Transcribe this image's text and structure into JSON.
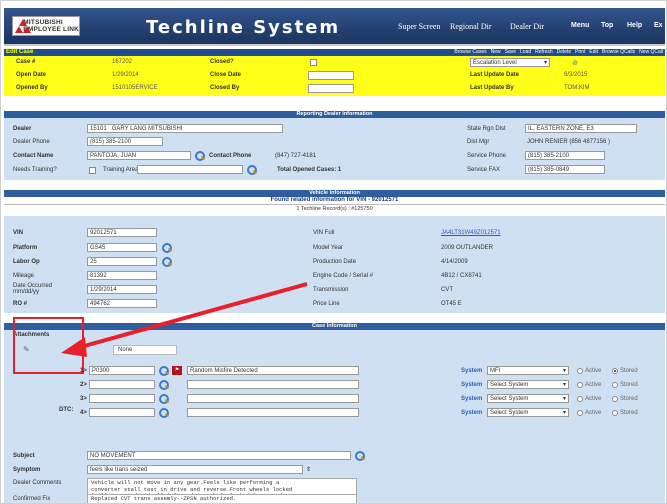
{
  "header": {
    "logo_text": "MITSUBISHI\nEMPLOYEE LINK",
    "title": "Techline System",
    "nav": [
      "Super Screen",
      "Regional Dir",
      "Dealer Dir",
      "Menu",
      "Top",
      "Help",
      "Ex"
    ]
  },
  "toolbar": {
    "title": "Edit Case",
    "tools": [
      "Browse Cases",
      "New",
      "Save",
      "Load",
      "Refresh",
      "Delete",
      "Print",
      "Edit",
      "Browse QCalls",
      "New QCall"
    ]
  },
  "case": {
    "case_label": "Case #",
    "case_val": "167202",
    "open_label": "Open Date",
    "open_val": "1/29/2014",
    "by_label": "Opened By",
    "by_val": "1510105ERVICE",
    "closed_label": "Closed?",
    "closedate_label": "Close Date",
    "closedby_label": "Closed By",
    "escalation": "Escalation Level",
    "lastdate_label": "Last Update Date",
    "lastdate_val": "6/3/2015",
    "lastby_label": "Last Update By",
    "lastby_val": "TOM.KIM"
  },
  "dealer": {
    "section": "Reporting Dealer Information",
    "dealer_label": "Dealer",
    "dealer_code": "15101",
    "dealer_name": "GARY LANG MITSUBISHI",
    "phone_label": "Dealer Phone",
    "phone_val": "(815) 385-2100",
    "contact_label": "Contact Name",
    "contact_val": "PANTOJA, JUAN",
    "cphone_label": "Contact Phone",
    "cphone_val": "(847) 727-4181",
    "training_label": "Needs Training?",
    "training_area": "Training Area",
    "total_label": "Total Opened Cases: 1",
    "state_label": "State Rgn Dist",
    "state_val": "IL, EASTERN ZONE, E3",
    "mgr_label": "Dist Mgr",
    "mgr_val": "JOHN RENIER (856 4877156 )",
    "svc_label": "Service Phone",
    "svc_val": "(815) 385-2100",
    "fax_label": "Service FAX",
    "fax_val": "(815) 385-0849"
  },
  "vehicle": {
    "section": "Vehicle Information",
    "found": "Found related information for VIN - 92012571",
    "records": "1 Techline Record(s) : #125750",
    "vin_label": "VIN",
    "vin_val": "92012571",
    "platform_label": "Platform",
    "platform_val": "GS45",
    "laborop_label": "Labor Op",
    "laborop_val": "25",
    "mileage_label": "Mileage",
    "mileage_val": "81392",
    "date_label": "Date Occurred mm/dd/yy",
    "date_val": "1/29/2014",
    "ro_label": "RO #",
    "ro_val": "494762",
    "vinfull_label": "VIN Full",
    "vinfull_val": "JA4LT31W49Z012571",
    "model_label": "Model Year",
    "model_val": "2009 OUTLANDER",
    "prod_label": "Production Date",
    "prod_val": "4/14/2009",
    "engine_label": "Engine Code / Serial #",
    "engine_val": "4B12 / CX8741",
    "trans_label": "Transmission",
    "trans_val": "CVT",
    "price_label": "Price Line",
    "price_val": "OT45 E"
  },
  "caseinfo": {
    "section": "Case Information",
    "attach_label": "Attachments",
    "none": "None",
    "dtc_label": "DTC:",
    "dtc": [
      {
        "n": "1>",
        "code": "P0300",
        "desc": "Random Misfire Detected",
        "system": "MFI"
      },
      {
        "n": "2>",
        "code": "",
        "desc": "",
        "system": "Select System"
      },
      {
        "n": "3>",
        "code": "",
        "desc": "",
        "system": "Select System"
      },
      {
        "n": "4>",
        "code": "",
        "desc": "",
        "system": "Select System"
      }
    ],
    "system_label": "System",
    "active": "Active",
    "stored": "Stored",
    "subject_label": "Subject",
    "subject_val": "NO MOVEMENT",
    "symptom_label": "Symptom",
    "symptom_val": "feels like trans seized",
    "comments_label": "Dealer Comments",
    "comments_val": "Vehicle will not move in any gear.Feels like performing a\nconverter stall test in drive and reverse.Front wheels locked\n(will turn individually).Rear drive shaft locked.Separated",
    "fix_label": "Confirmed Fix",
    "fix_val": "Replaced CVT trans assemly--ZPSN authorized."
  },
  "colors": {
    "header": "#23406f",
    "yellow": "#ffff19",
    "section": "#2f5e9e",
    "annotation": "#e8202a"
  }
}
